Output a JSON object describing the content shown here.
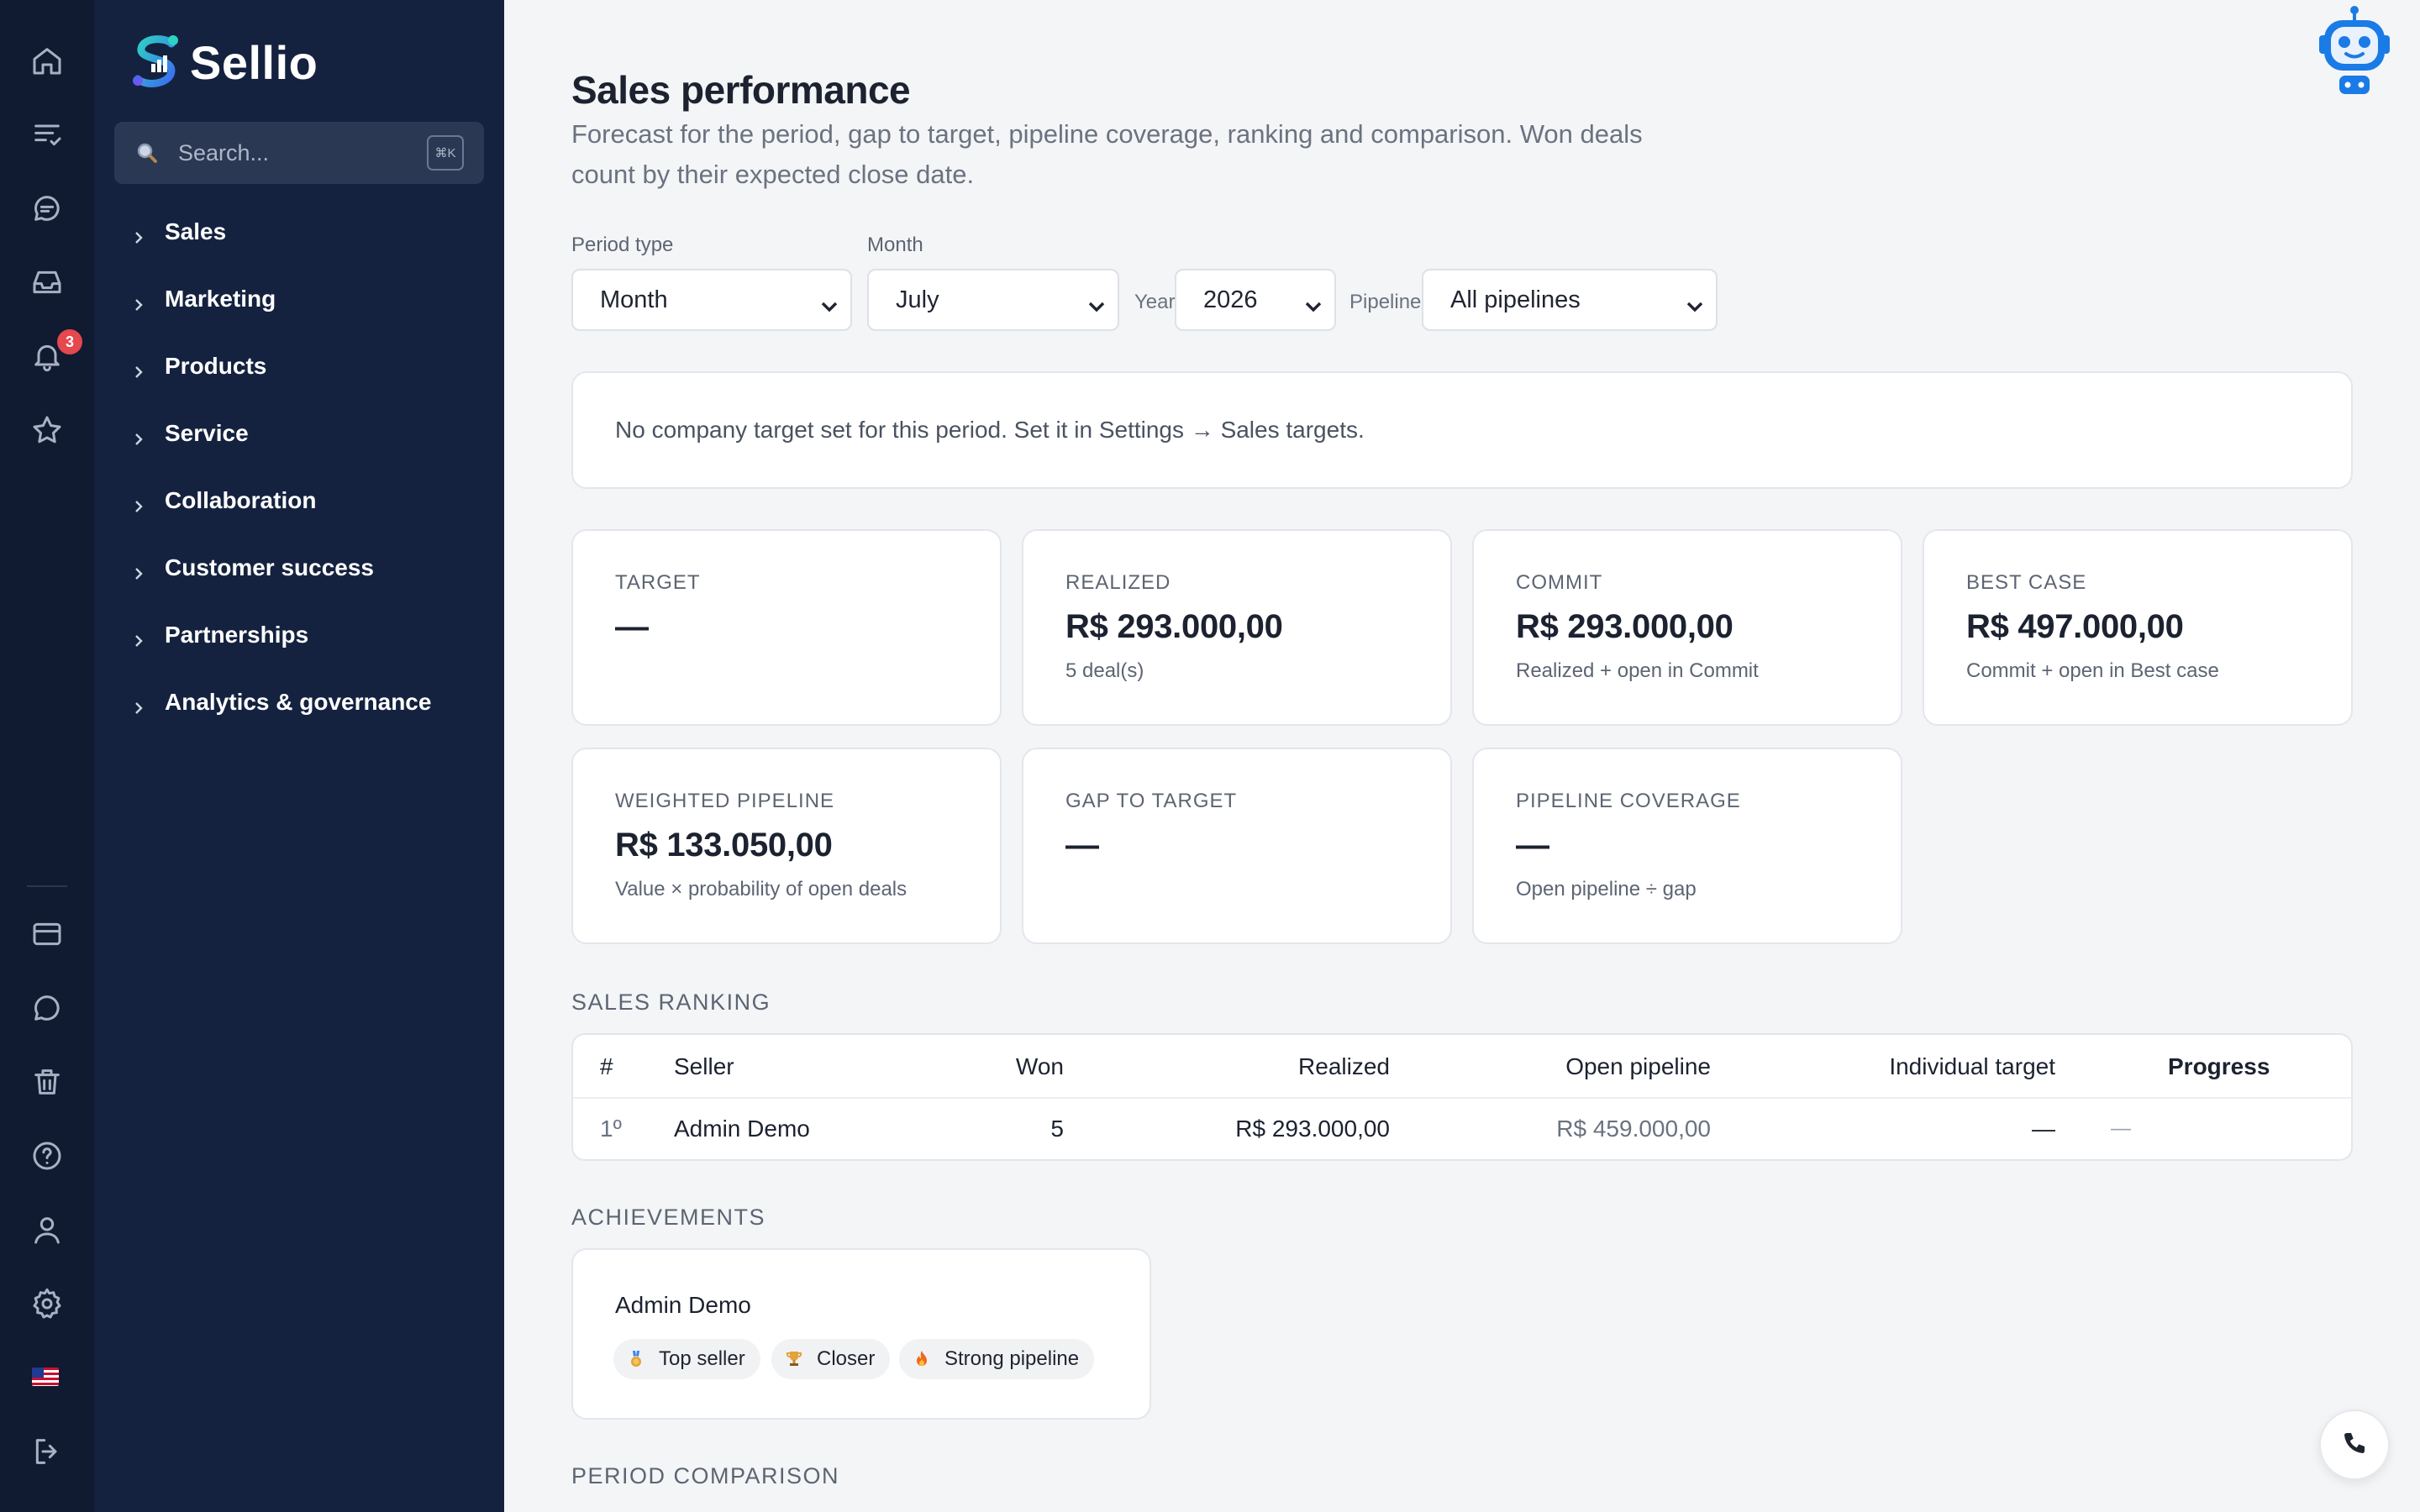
{
  "app": {
    "name": "Sellio"
  },
  "rail": {
    "notification_count": "3"
  },
  "sidebar": {
    "search_placeholder": "Search...",
    "search_shortcut": "⌘K",
    "items": [
      {
        "label": "Sales"
      },
      {
        "label": "Marketing"
      },
      {
        "label": "Products"
      },
      {
        "label": "Service"
      },
      {
        "label": "Collaboration"
      },
      {
        "label": "Customer success"
      },
      {
        "label": "Partnerships"
      },
      {
        "label": "Analytics & governance"
      }
    ]
  },
  "page": {
    "title": "Sales performance",
    "subtitle": "Forecast for the period, gap to target, pipeline coverage, ranking and comparison. Won deals count by their expected close date."
  },
  "filters": {
    "period_type_label": "Period type",
    "period_type_value": "Month",
    "month_label": "Month",
    "month_value": "July",
    "year_label": "Year",
    "year_value": "2026",
    "pipeline_label": "Pipeline",
    "pipeline_value": "All pipelines"
  },
  "notice": "No company target set for this period. Set it in Settings → Sales targets.",
  "kpis": {
    "target": {
      "label": "TARGET",
      "value": "—"
    },
    "realized": {
      "label": "REALIZED",
      "value": "R$ 293.000,00",
      "sub": "5 deal(s)"
    },
    "commit": {
      "label": "COMMIT",
      "value": "R$ 293.000,00",
      "sub": "Realized + open in Commit"
    },
    "best_case": {
      "label": "BEST CASE",
      "value": "R$ 497.000,00",
      "sub": "Commit + open in Best case"
    },
    "weighted": {
      "label": "WEIGHTED PIPELINE",
      "value": "R$ 133.050,00",
      "sub": "Value × probability of open deals"
    },
    "gap": {
      "label": "GAP TO TARGET",
      "value": "—"
    },
    "coverage": {
      "label": "PIPELINE COVERAGE",
      "value": "—",
      "sub": "Open pipeline ÷ gap"
    }
  },
  "ranking": {
    "section_title": "SALES RANKING",
    "headers": {
      "rank": "#",
      "seller": "Seller",
      "won": "Won",
      "realized": "Realized",
      "open": "Open pipeline",
      "target": "Individual target",
      "progress": "Progress"
    },
    "rows": [
      {
        "rank": "1º",
        "seller": "Admin Demo",
        "won": "5",
        "realized": "R$ 293.000,00",
        "open": "R$ 459.000,00",
        "target": "—",
        "progress": "—"
      }
    ]
  },
  "achievements": {
    "section_title": "ACHIEVEMENTS",
    "name": "Admin Demo",
    "chips": [
      "Top seller",
      "Closer",
      "Strong pipeline"
    ]
  },
  "comparison": {
    "section_title": "PERIOD COMPARISON"
  },
  "colors": {
    "rail_bg": "#101a30",
    "sidebar_bg": "#14223f",
    "page_bg": "#f4f5f7",
    "badge": "#e5484d",
    "brand_blue": "#1a7be6"
  }
}
